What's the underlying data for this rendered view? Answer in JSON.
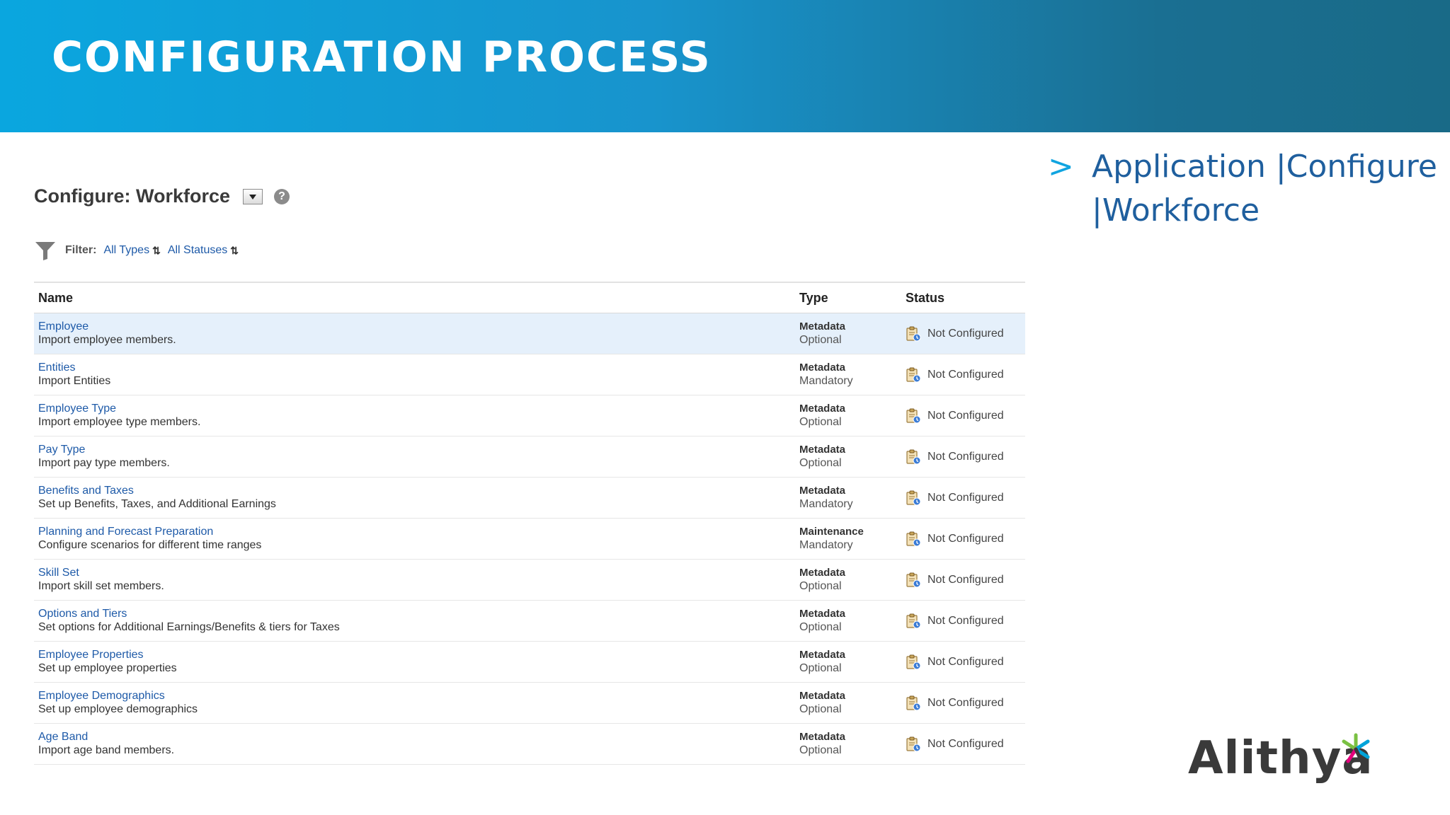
{
  "slide": {
    "title": "CONFIGURATION PROCESS"
  },
  "configure": {
    "title": "Configure: Workforce",
    "filter_label": "Filter:",
    "filter_type": "All Types",
    "filter_status": "All Statuses",
    "columns": {
      "name": "Name",
      "type": "Type",
      "status": "Status"
    },
    "rows": [
      {
        "name": "Employee",
        "desc": "Import employee members.",
        "type": "Metadata",
        "req": "Optional",
        "status": "Not Configured"
      },
      {
        "name": "Entities",
        "desc": "Import Entities",
        "type": "Metadata",
        "req": "Mandatory",
        "status": "Not Configured"
      },
      {
        "name": "Employee Type",
        "desc": "Import employee type members.",
        "type": "Metadata",
        "req": "Optional",
        "status": "Not Configured"
      },
      {
        "name": "Pay Type",
        "desc": "Import pay type members.",
        "type": "Metadata",
        "req": "Optional",
        "status": "Not Configured"
      },
      {
        "name": "Benefits and Taxes",
        "desc": "Set up Benefits, Taxes, and Additional Earnings",
        "type": "Metadata",
        "req": "Mandatory",
        "status": "Not Configured"
      },
      {
        "name": "Planning and Forecast Preparation",
        "desc": "Configure scenarios for different time ranges",
        "type": "Maintenance",
        "req": "Mandatory",
        "status": "Not Configured"
      },
      {
        "name": "Skill Set",
        "desc": "Import skill set members.",
        "type": "Metadata",
        "req": "Optional",
        "status": "Not Configured"
      },
      {
        "name": "Options and Tiers",
        "desc": "Set options for Additional Earnings/Benefits & tiers for Taxes",
        "type": "Metadata",
        "req": "Optional",
        "status": "Not Configured"
      },
      {
        "name": "Employee Properties",
        "desc": "Set up employee properties",
        "type": "Metadata",
        "req": "Optional",
        "status": "Not Configured"
      },
      {
        "name": "Employee Demographics",
        "desc": "Set up employee demographics",
        "type": "Metadata",
        "req": "Optional",
        "status": "Not Configured"
      },
      {
        "name": "Age Band",
        "desc": "Import age band members.",
        "type": "Metadata",
        "req": "Optional",
        "status": "Not Configured"
      }
    ]
  },
  "navigation": {
    "chevron": ">",
    "line1": "Application |Configure",
    "line2": "|Workforce"
  },
  "logo": {
    "text": "Alithya"
  },
  "colors": {
    "banner_start": "#0aa6df",
    "banner_end": "#196a87",
    "link": "#1e5aa8",
    "nav_text": "#1f5f9e",
    "selected_row": "#e5f0fb"
  }
}
